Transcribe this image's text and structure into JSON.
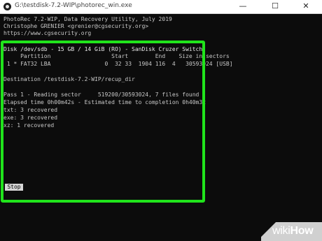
{
  "window": {
    "title": "G:\\testdisk-7.2-WIP\\photorec_win.exe",
    "minimize": "—",
    "maximize": "☐",
    "close": "✕"
  },
  "console": {
    "header": [
      "PhotoRec 7.2-WIP, Data Recovery Utility, July 2019",
      "Christophe GRENIER <grenier@cgsecurity.org>",
      "https://www.cgsecurity.org"
    ],
    "disk_line": "Disk /dev/sdb - 15 GB / 14 GiB (RO) - SanDisk Cruzer Switch",
    "partition_header": "     Partition                  Start        End    Size in sectors",
    "partition_row": " 1 * FAT32 LBA                0  32 33  1904 116  4   30593024 [USB]",
    "destination": "Destination /testdisk-7.2-WIP/recup_dir",
    "pass_line": "Pass 1 - Reading sector     519200/30593024, 7 files found",
    "elapsed": "Elapsed time 0h00m42s - Estimated time to completion 0h40m32",
    "recovered": [
      "txt: 3 recovered",
      "exe: 3 recovered",
      "xz: 1 recovered"
    ],
    "stop_label": "Stop"
  },
  "watermark": {
    "prefix": "wiki",
    "suffix": "How"
  },
  "colors": {
    "highlight": "#20e41b",
    "console_bg": "#0c0c0c",
    "console_text": "#c8c8c8"
  }
}
